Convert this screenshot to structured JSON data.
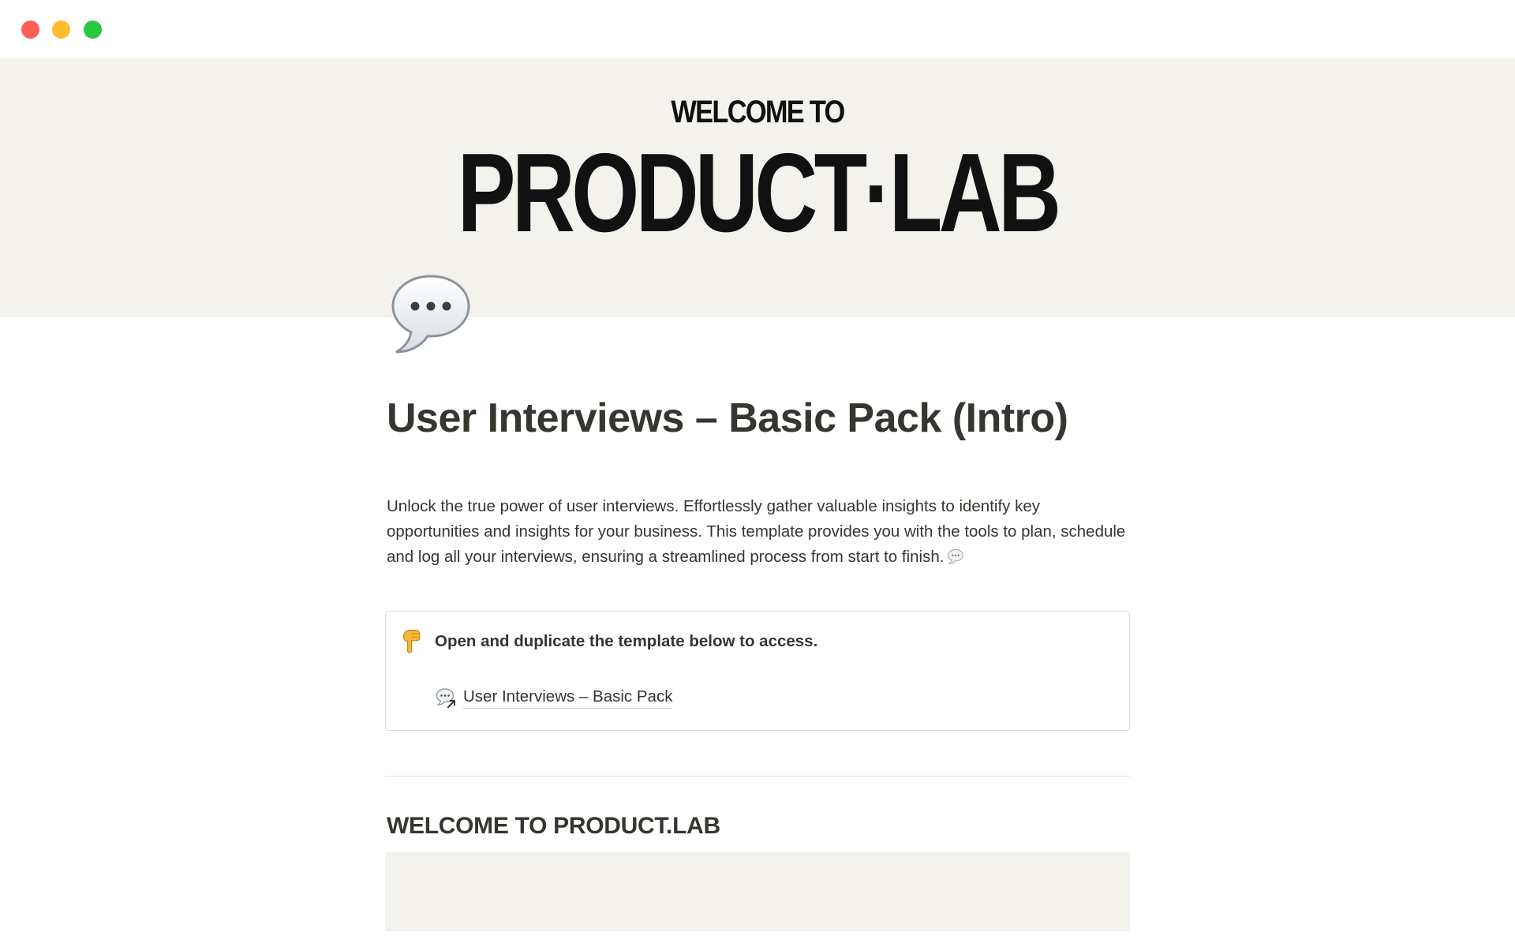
{
  "window": {
    "controls": [
      "close",
      "minimize",
      "maximize"
    ],
    "colors": {
      "close": "#fe5f57",
      "minimize": "#febc2e",
      "maximize": "#28c840"
    }
  },
  "cover": {
    "kicker": "WELCOME TO",
    "title": "PRODUCT·LAB",
    "background": "#f3f2ec"
  },
  "page": {
    "icon": "speech-bubble-icon",
    "title": "User Interviews – Basic Pack (Intro)",
    "intro": "Unlock the true power of user interviews. Effortlessly gather valuable insights to identify key opportunities and insights for your business. This template provides you with the tools to plan, schedule and log all your interviews, ensuring a streamlined process from start to finish.",
    "intro_trailing_icon": "speech-bubble-icon"
  },
  "callout": {
    "icon": "pointing-down-hand-icon",
    "text": "Open and duplicate the template below to access.",
    "link": {
      "icon": "speech-bubble-link-icon",
      "label": "User Interviews – Basic Pack"
    }
  },
  "section": {
    "heading": "WELCOME TO PRODUCT.LAB"
  }
}
